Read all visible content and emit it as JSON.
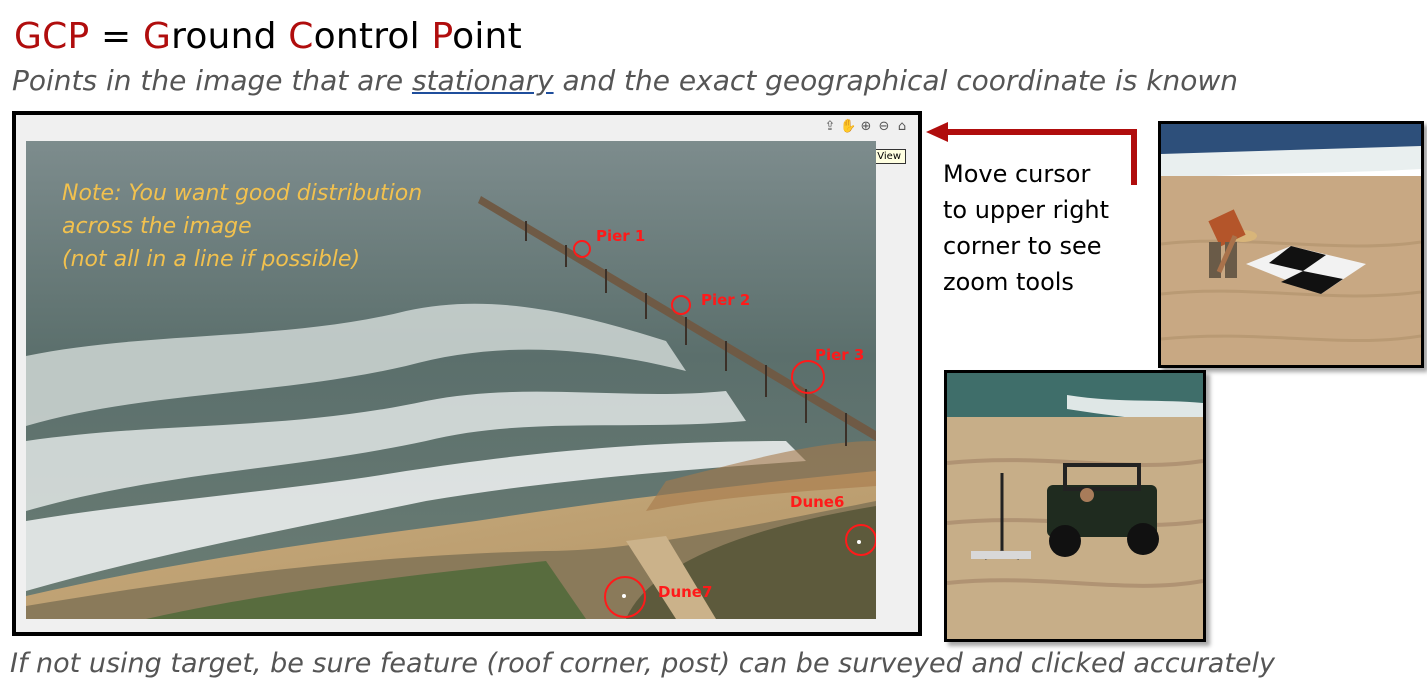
{
  "title": {
    "g": "G",
    "cp": "CP",
    " eq": " = ",
    "w1a": "G",
    "w1b": "round ",
    "w2a": "C",
    "w2b": "ontrol ",
    "w3a": "P",
    "w3b": "oint"
  },
  "subtitle": {
    "pre": "Points in the image that are ",
    "underlined": "stationary",
    "post": " and the exact geographical coordinate is known"
  },
  "viewer": {
    "tooltip": "Restore View",
    "toolbar_icons": [
      "export-icon",
      "pan-hand-icon",
      "zoom-in-icon",
      "zoom-out-icon",
      "home-icon"
    ],
    "note_lines": [
      "Note: You want good distribution",
      "across the image",
      "(not all in a line if possible)"
    ],
    "gcps": [
      "Pier 1",
      "Pier 2",
      "Pier 3",
      "Dune6",
      "Dune7"
    ]
  },
  "instruction": {
    "lines": [
      "Move cursor",
      "to upper right",
      "corner to see",
      "zoom tools"
    ]
  },
  "footer": "If not using target, be sure feature (roof corner, post) can be surveyed and clicked accurately",
  "colors": {
    "accent_red": "#b00d0d",
    "gcp_red": "#ff1a1a",
    "note_yellow": "#f2c14e"
  }
}
